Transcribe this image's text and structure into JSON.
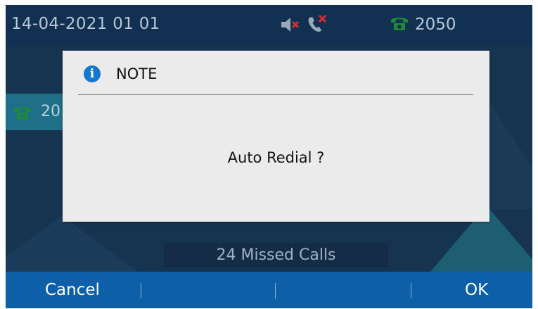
{
  "status_bar": {
    "datetime": "14-04-2021 01 01",
    "line_number": "2050",
    "icons": [
      "speaker-muted-icon",
      "missed-call-icon",
      "phone-icon"
    ]
  },
  "account_tab": {
    "label": "20",
    "icon": "phone-icon"
  },
  "dialog": {
    "title": "NOTE",
    "icon": "info-icon",
    "message": "Auto Redial ?"
  },
  "missed_calls": "24 Missed Calls",
  "softkeys": {
    "left": "Cancel",
    "right": "OK"
  },
  "colors": {
    "background": "#16334f",
    "softkey_bar": "#0d5fa8",
    "dialog_bg": "#ebebeb",
    "accent_info": "#1579d1",
    "phone_green": "#1f8a3a",
    "alert_red": "#d0312d"
  }
}
